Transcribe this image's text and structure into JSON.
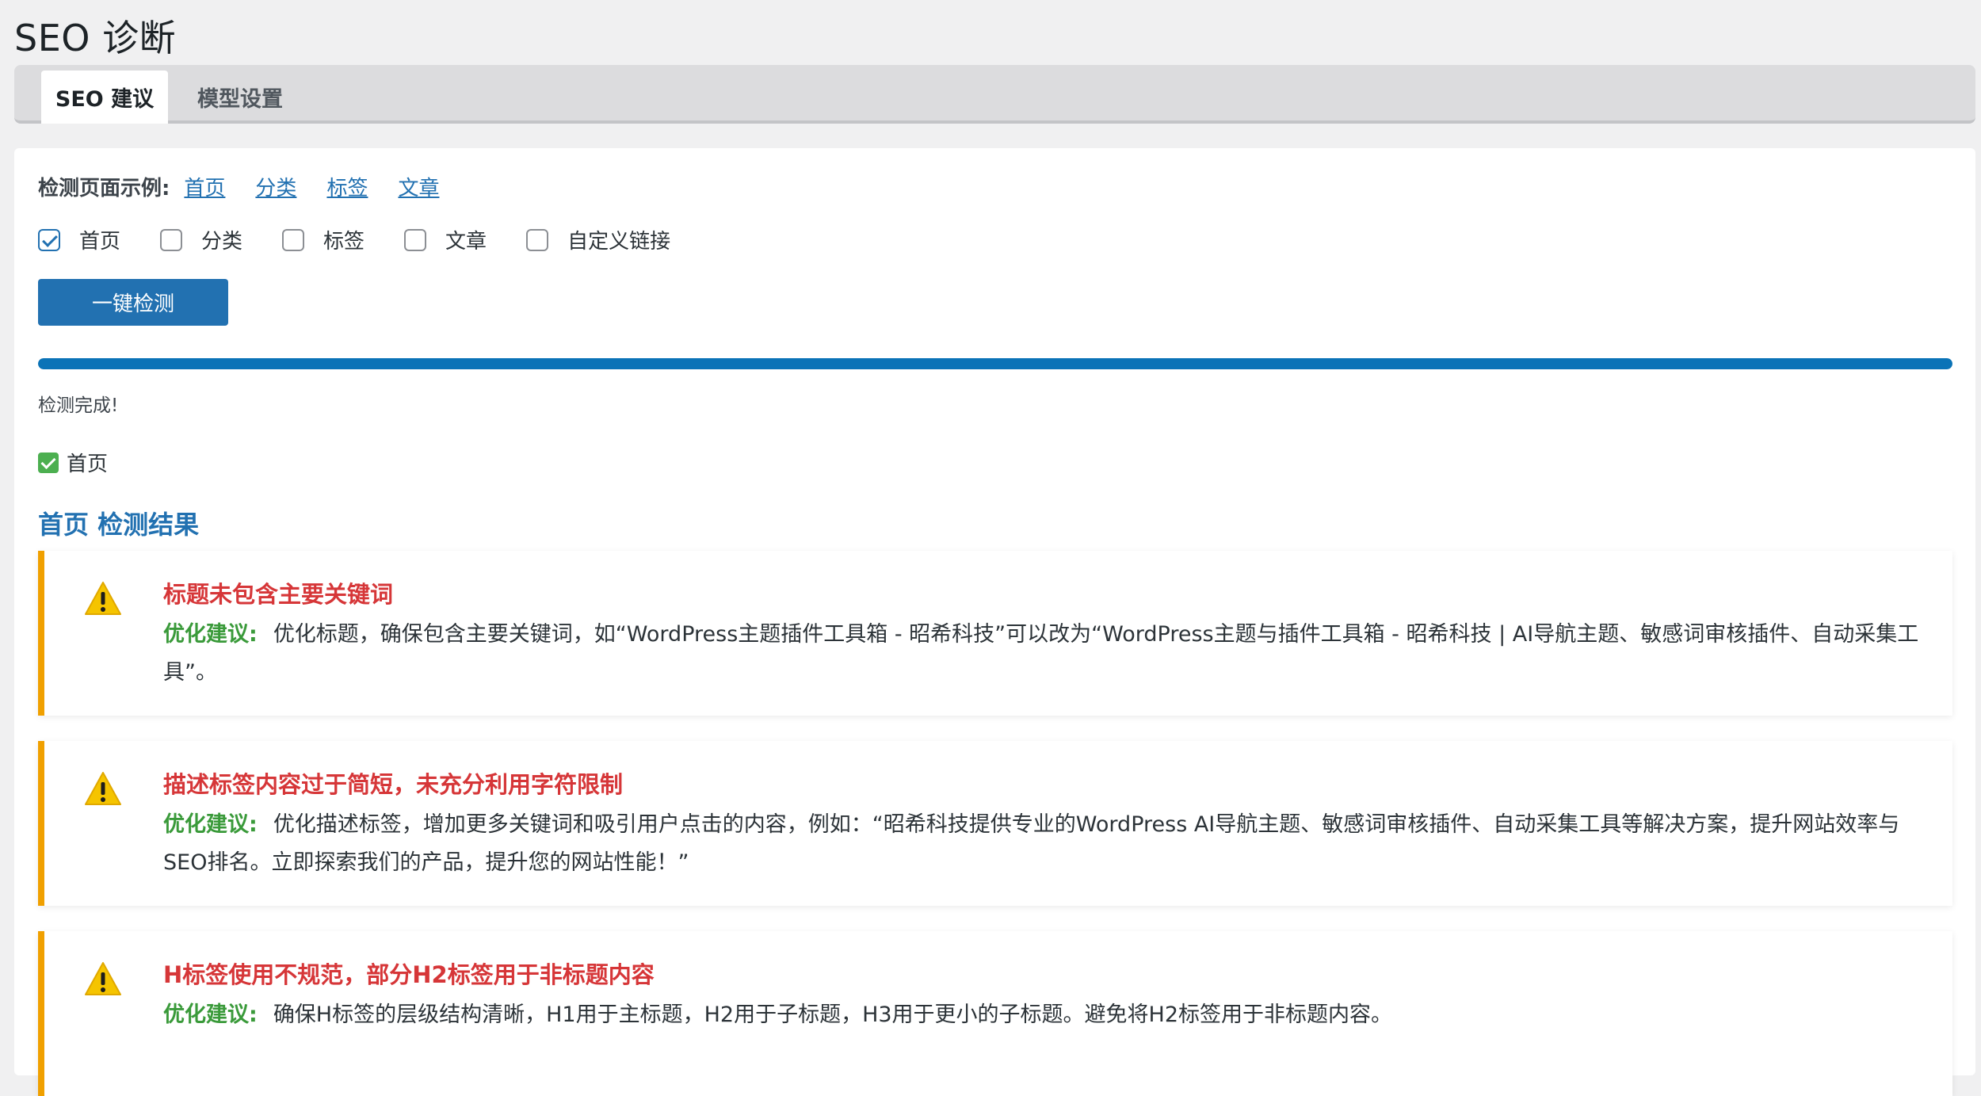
{
  "page_title": "SEO 诊断",
  "tabs": [
    {
      "label": "SEO 建议",
      "active": true
    },
    {
      "label": "模型设置",
      "active": false
    }
  ],
  "examples": {
    "label": "检测页面示例:",
    "links": [
      "首页",
      "分类",
      "标签",
      "文章"
    ]
  },
  "checkboxes": [
    {
      "label": "首页",
      "checked": true
    },
    {
      "label": "分类",
      "checked": false
    },
    {
      "label": "标签",
      "checked": false
    },
    {
      "label": "文章",
      "checked": false
    },
    {
      "label": "自定义链接",
      "checked": false
    }
  ],
  "run_button": "一键检测",
  "progress": 100,
  "status": "检测完成!",
  "done_item": "首页",
  "result_title": "首页 检测结果",
  "suggestion_label": "优化建议:",
  "issues": [
    {
      "title": "标题未包含主要关键词",
      "suggestion": "优化标题，确保包含主要关键词，如“WordPress主题插件工具箱 - 昭希科技”可以改为“WordPress主题与插件工具箱 - 昭希科技 | AI导航主题、敏感词审核插件、自动采集工具”。"
    },
    {
      "title": "描述标签内容过于简短，未充分利用字符限制",
      "suggestion": "优化描述标签，增加更多关键词和吸引用户点击的内容，例如：“昭希科技提供专业的WordPress AI导航主题、敏感词审核插件、自动采集工具等解决方案，提升网站效率与SEO排名。立即探索我们的产品，提升您的网站性能！”"
    },
    {
      "title": "H标签使用不规范，部分H2标签用于非标题内容",
      "suggestion": "确保H标签的层级结构清晰，H1用于主标题，H2用于子标题，H3用于更小的子标题。避免将H2标签用于非标题内容。"
    }
  ],
  "colors": {
    "primary": "#2271b1",
    "warning_border": "#f0a000",
    "issue_title": "#d63638",
    "suggestion_label": "#3a9a3a"
  }
}
